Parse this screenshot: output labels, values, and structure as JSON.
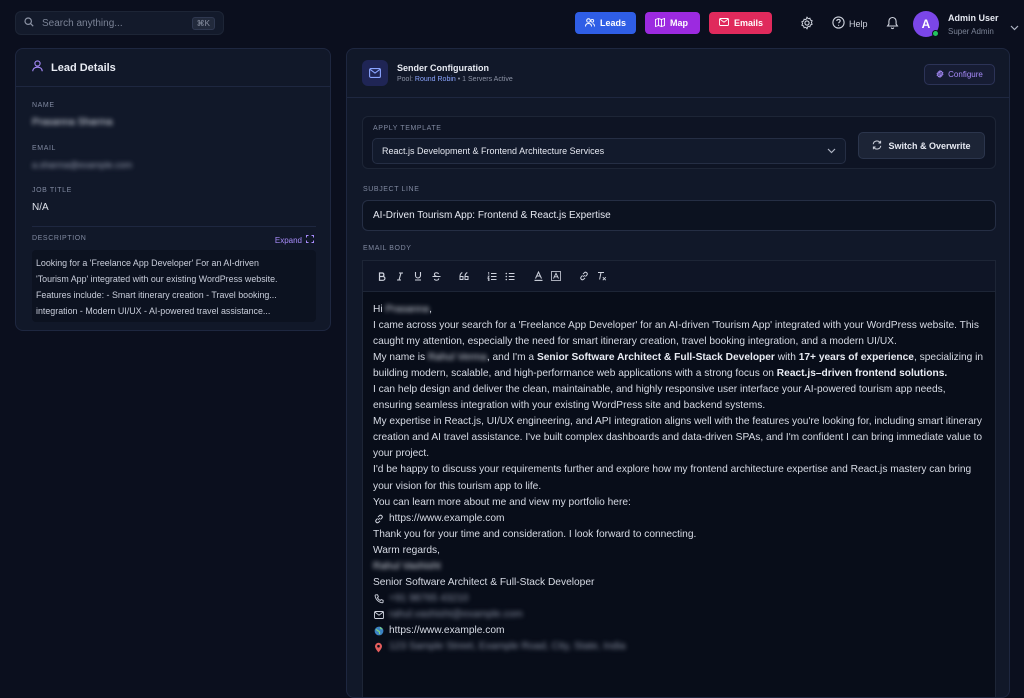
{
  "search": {
    "placeholder": "Search anything...",
    "shortcut": "⌘K"
  },
  "nav": {
    "leads": "Leads",
    "map": "Map",
    "emails": "Emails",
    "help": "Help"
  },
  "user": {
    "name": "Admin User",
    "role": "Super Admin",
    "initial": "A"
  },
  "lead": {
    "title": "Lead Details",
    "name_label": "NAME",
    "name_value": "Prasanna Sharma",
    "email_label": "EMAIL",
    "email_value": "a.sharma@example.com",
    "job_label": "JOB TITLE",
    "job_value": "N/A",
    "desc_label": "DESCRIPTION",
    "expand": "Expand",
    "desc_lines": [
      "Looking for a 'Freelance App Developer' For an AI-driven",
      "'Tourism App' integrated with our existing WordPress website.",
      "Features include: - Smart itinerary creation - Travel booking...",
      "integration - Modern UI/UX - AI-powered travel assistance..."
    ]
  },
  "sender": {
    "title": "Sender Configuration",
    "pool_prefix": "Pool:",
    "pool_name": "Round Robin",
    "pool_suffix": "• 1 Servers Active",
    "configure": "Configure"
  },
  "template": {
    "label": "APPLY TEMPLATE",
    "selected": "React.js Development & Frontend Architecture Services",
    "switch": "Switch & Overwrite"
  },
  "subject": {
    "label": "SUBJECT LINE",
    "value": "AI-Driven Tourism App: Frontend & React.js Expertise"
  },
  "body": {
    "label": "EMAIL BODY",
    "greeting": "Hi",
    "greeting_name": "Prasanna",
    "p1": "I came across your search for a 'Freelance App Developer' for an AI-driven 'Tourism App' integrated with your WordPress website. This caught my attention, especially the need for smart itinerary creation, travel booking integration, and a modern UI/UX.",
    "p2_a": "My name is",
    "p2_name": "Rahul Verma",
    "p2_b": ", and I'm a",
    "p2_bold1": "Senior Software Architect & Full-Stack Developer",
    "p2_c": "with",
    "p2_bold2": "17+ years of experience",
    "p2_d": ", specializing in building modern, scalable, and high-performance web applications with a strong focus on",
    "p2_bold3": "React.js–driven frontend solutions.",
    "p3": "I can help design and deliver the clean, maintainable, and highly responsive user interface your AI-powered tourism app needs, ensuring seamless integration with your existing WordPress site and backend systems.",
    "p4": "My expertise in React.js, UI/UX engineering, and API integration aligns well with the features you're looking for, including smart itinerary creation and AI travel assistance. I've built complex dashboards and data-driven SPAs, and I'm confident I can bring immediate value to your project.",
    "p5": "I'd be happy to discuss your requirements further and explore how my frontend architecture expertise and React.js mastery can bring your vision for this tourism app to life.",
    "p6": "You can learn more about me and view my portfolio here:",
    "portfolio": "https://www.example.com",
    "thanks": "Thank you for your time and consideration. I look forward to connecting.",
    "regards": "Warm regards,",
    "sig_name": "Rahul Vashisht",
    "sig_title": "Senior Software Architect & Full-Stack Developer",
    "phone": "+91 98765 43210",
    "email": "rahul.vashisht@example.com",
    "website": "https://www.example.com",
    "address": "123 Sample Street, Example Road, City, State, India"
  },
  "colors": {
    "leads": "#2f5ee6",
    "map": "#9c2ae0",
    "emails": "#e02a5c",
    "accent": "#a78bfa",
    "online": "#22c55e"
  }
}
